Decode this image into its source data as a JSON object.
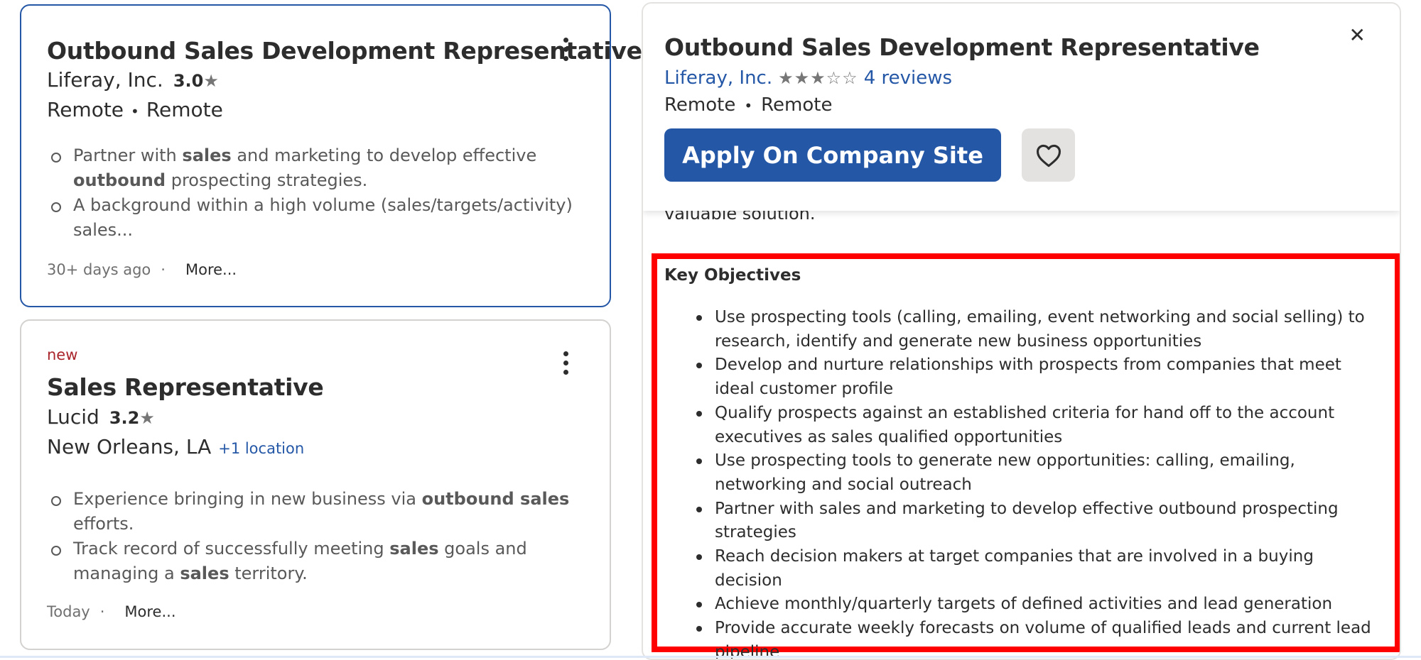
{
  "cards": [
    {
      "title": "Outbound Sales Development Representative",
      "company": "Liferay, Inc.",
      "rating": "3.0",
      "location_a": "Remote",
      "location_b": "Remote",
      "snippet_1_pre": "Partner with ",
      "snippet_1_b1": "sales",
      "snippet_1_mid": " and marketing to develop effective ",
      "snippet_1_b2": "outbound",
      "snippet_1_post": " prospecting strategies.",
      "snippet_2": "A background within a high volume (sales/targets/activity) sales...",
      "posted": "30+ days ago",
      "more": "More..."
    },
    {
      "new_tag": "new",
      "title": "Sales Representative",
      "company": "Lucid",
      "rating": "3.2",
      "location": "New Orleans, LA",
      "extra_location": "+1 location",
      "snippet_1_pre": "Experience bringing in new business via ",
      "snippet_1_b1": "outbound sales",
      "snippet_1_post": " efforts.",
      "snippet_2_pre": "Track record of successfully meeting ",
      "snippet_2_b1": "sales",
      "snippet_2_mid": " goals and managing a ",
      "snippet_2_b2": "sales",
      "snippet_2_post": " territory.",
      "posted": "Today",
      "more": "More..."
    }
  ],
  "detail": {
    "title": "Outbound Sales Development Representative",
    "company": "Liferay, Inc.",
    "stars": "★★★☆☆",
    "reviews": "4 reviews",
    "location_a": "Remote",
    "location_b": "Remote",
    "apply_label": "Apply On Company Site",
    "cut_text": "valuable solution.",
    "objectives_heading": "Key Objectives",
    "objectives": [
      "Use prospecting tools (calling, emailing, event networking and social selling) to research, identify and generate new business opportunities",
      "Develop and nurture relationships with prospects from companies that meet ideal customer profile",
      "Qualify prospects against an established criteria for hand off to the account executives as sales qualified opportunities",
      "Use prospecting tools to generate new opportunities: calling, emailing, networking and social outreach",
      "Partner with sales and marketing to develop effective outbound prospecting strategies",
      "Reach decision makers at target companies that are involved in a buying decision",
      "Achieve monthly/quarterly targets of defined activities and lead generation",
      "Provide accurate weekly forecasts on volume of qualified leads and current lead pipeline"
    ]
  },
  "symbols": {
    "star": "★",
    "bullet_sep": "•",
    "footer_sep": "·",
    "close": "✕"
  },
  "colors": {
    "primary": "#2557a7",
    "new": "#a9252b",
    "highlight": "#ff0000"
  }
}
